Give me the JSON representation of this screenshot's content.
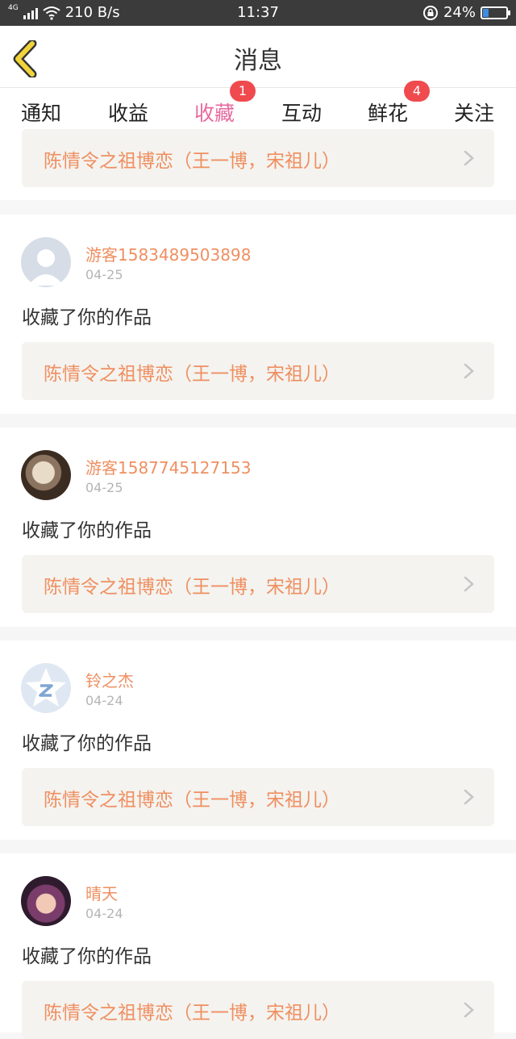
{
  "status_bar": {
    "network": "4G",
    "speed": "210 B/s",
    "time": "11:37",
    "battery": "24%",
    "battery_level": 0.24
  },
  "header": {
    "title": "消息"
  },
  "tabs": [
    {
      "label": "通知"
    },
    {
      "label": "收益"
    },
    {
      "label": "收藏",
      "badge": "1",
      "active": true
    },
    {
      "label": "互动"
    },
    {
      "label": "鲜花",
      "badge": "4"
    },
    {
      "label": "关注"
    }
  ],
  "feed": {
    "partial_top": {
      "work_title": "陈情令之祖博恋（王一博，宋祖儿）"
    },
    "items": [
      {
        "username": "游客1583489503898",
        "date": "04-25",
        "action": "收藏了你的作品",
        "work_title": "陈情令之祖博恋（王一博，宋祖儿）",
        "avatar": "default-person-avatar"
      },
      {
        "username": "游客1587745127153",
        "date": "04-25",
        "action": "收藏了你的作品",
        "work_title": "陈情令之祖博恋（王一博，宋祖儿）",
        "avatar": "photo-avatar"
      },
      {
        "username": "铃之杰",
        "date": "04-24",
        "action": "收藏了你的作品",
        "work_title": "陈情令之祖博恋（王一博，宋祖儿）",
        "avatar": "qq-star-avatar"
      },
      {
        "username": "晴天",
        "date": "04-24",
        "action": "收藏了你的作品",
        "work_title": "陈情令之祖博恋（王一博，宋祖儿）",
        "avatar": "photo-avatar"
      }
    ]
  },
  "colors": {
    "accent_pink": "#e76aa0",
    "badge_red": "#ef4a4e",
    "orange_text": "#ef8f61",
    "back_arrow_yellow": "#f2d33a"
  }
}
